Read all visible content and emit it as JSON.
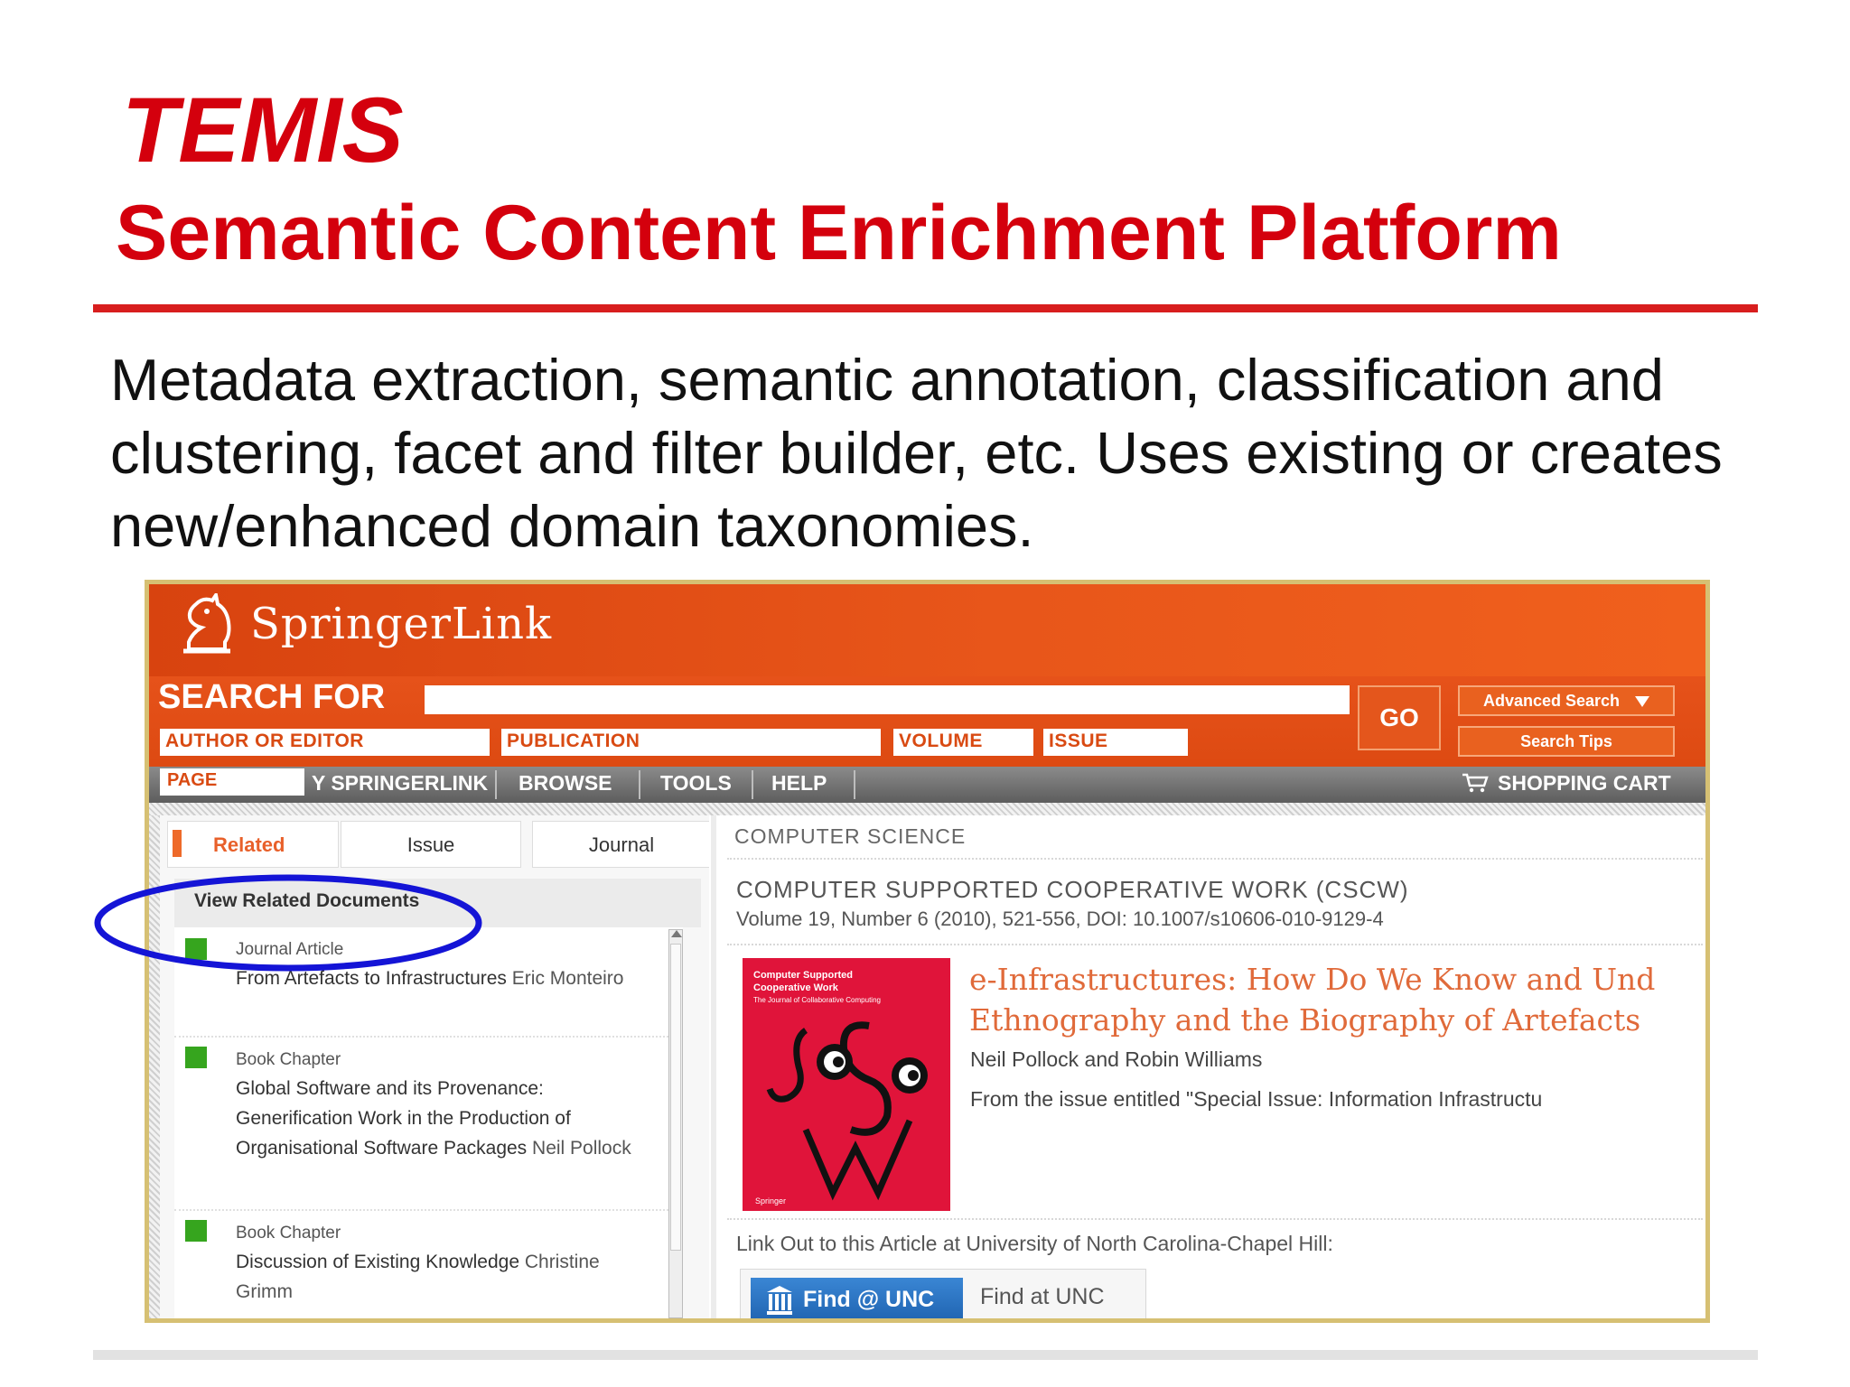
{
  "slide": {
    "title": "TEMIS",
    "subtitle": "Semantic Content Enrichment Platform",
    "body": "Metadata extraction, semantic annotation, classification and clustering, facet and filter builder, etc. Uses existing or creates new/enhanced domain taxonomies."
  },
  "colors": {
    "title_red": "#d4000d",
    "springer_orange": "#e8561a",
    "frame_gold": "#d6c073",
    "highlight_blue": "#1414d6",
    "related_marker_green": "#36a51e"
  },
  "springer": {
    "logo_icon": "springer-chess-knight-icon",
    "logo_text": "SpringerLink",
    "search": {
      "label": "SEARCH FOR",
      "go_label": "GO",
      "advanced_search": "Advanced Search",
      "search_tips": "Search Tips",
      "fields": {
        "author": "AUTHOR OR EDITOR",
        "publication": "PUBLICATION",
        "volume": "VOLUME",
        "issue": "ISSUE",
        "page": "PAGE"
      }
    },
    "nav": {
      "my_springerlink": "Y SPRINGERLINK",
      "browse": "BROWSE",
      "tools": "TOOLS",
      "help": "HELP",
      "shopping_cart": "SHOPPING CART",
      "cart_icon": "shopping-cart-icon"
    },
    "left": {
      "tabs": [
        "Related",
        "Issue",
        "Journal"
      ],
      "related_header": "View Related Documents",
      "items": [
        {
          "type": "Journal Article",
          "title": "From Artefacts to Infrastructures",
          "author": "Eric Monteiro"
        },
        {
          "type": "Book Chapter",
          "title": "Global Software and its Provenance: Generification Work in the Production of Organisational Software Packages",
          "author": "Neil Pollock"
        },
        {
          "type": "Book Chapter",
          "title": "Discussion of Existing Knowledge",
          "author": "Christine Grimm"
        }
      ]
    },
    "right": {
      "category": "COMPUTER SCIENCE",
      "journal_title": "COMPUTER SUPPORTED COOPERATIVE WORK (CSCW)",
      "journal_meta": "Volume 19, Number 6 (2010), 521-556, DOI: 10.1007/s10606-010-9129-4",
      "article_title_line1": "e-Infrastructures: How Do We Know and Und",
      "article_title_line2": "Ethnography and the Biography of Artefacts",
      "authors": "Neil Pollock and Robin Williams",
      "issue_text": "From the issue entitled \"Special Issue: Information Infrastructu",
      "cover": {
        "line1": "Computer Supported",
        "line2": "Cooperative Work",
        "line3": "The Journal of Collaborative Computing",
        "letters": "CSCW",
        "publisher": "Springer"
      },
      "linkout_text": "Link Out to this Article at University of North Carolina-Chapel Hill:",
      "find_unc_button": "Find @ UNC",
      "find_unc_text": "Find at UNC",
      "unc_icon": "unc-columns-icon"
    }
  }
}
